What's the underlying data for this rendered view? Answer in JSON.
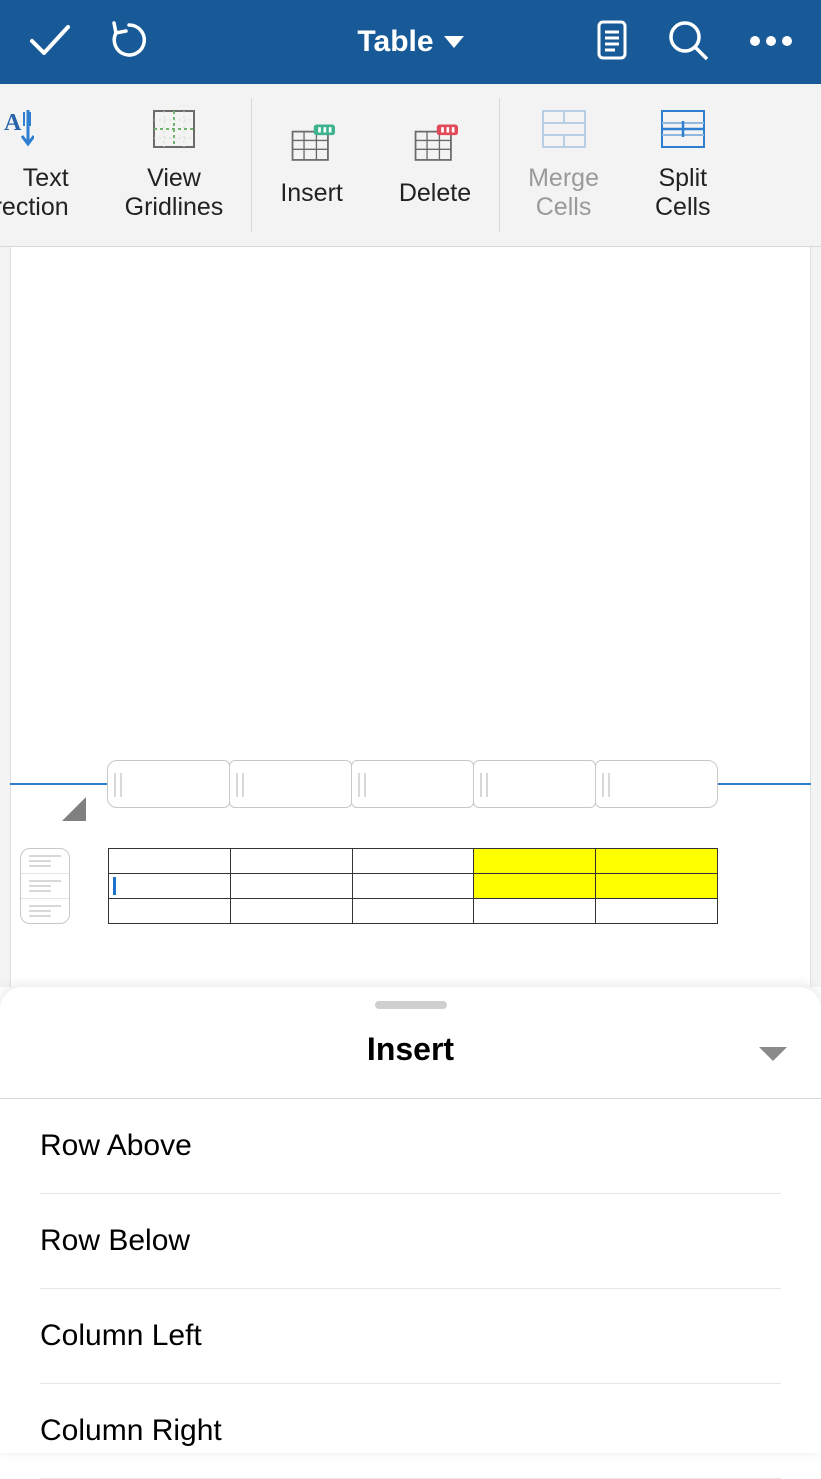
{
  "titlebar": {
    "tab_label": "Table"
  },
  "ribbon": {
    "text_direction": {
      "line1": "Text",
      "line2": "Direction"
    },
    "view_gridlines": {
      "line1": "View",
      "line2": "Gridlines"
    },
    "insert": "Insert",
    "delete": "Delete",
    "merge_cells": {
      "line1": "Merge",
      "line2": "Cells"
    },
    "split_cells": {
      "line1": "Split",
      "line2": "Cells"
    }
  },
  "table": {
    "rows": [
      {
        "cells": [
          "",
          "",
          "",
          "",
          ""
        ],
        "highlight": [
          3,
          4
        ]
      },
      {
        "cells": [
          "",
          "",
          "",
          "",
          ""
        ],
        "highlight": [
          3,
          4
        ]
      },
      {
        "cells": [
          "",
          "",
          "",
          "",
          ""
        ],
        "highlight": []
      }
    ],
    "cursor": {
      "row": 1,
      "col": 0
    }
  },
  "sheet": {
    "title": "Insert",
    "items": [
      "Row Above",
      "Row Below",
      "Column Left",
      "Column Right"
    ]
  }
}
